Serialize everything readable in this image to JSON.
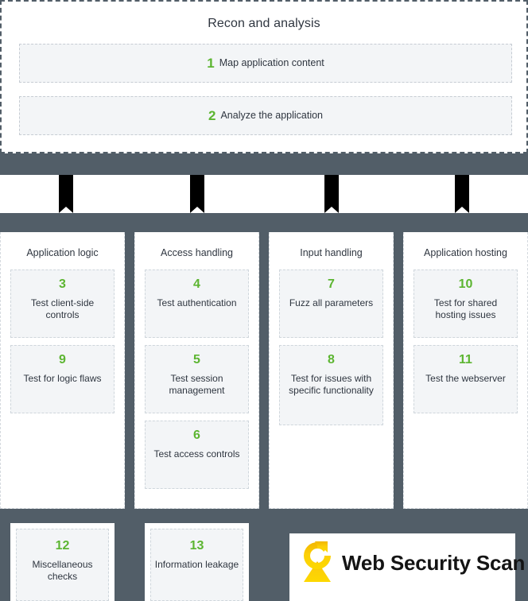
{
  "colors": {
    "dark_band": "#525e68",
    "accent_green": "#5cb531",
    "card_bg": "#f3f5f7",
    "text": "#2f3640",
    "logo_gold": "#f0b800",
    "logo_yellow": "#ffd400"
  },
  "recon": {
    "title": "Recon and analysis",
    "steps": [
      {
        "num": "1",
        "label": "Map application content"
      },
      {
        "num": "2",
        "label": "Analyze the application"
      }
    ]
  },
  "columns": [
    {
      "title": "Application logic",
      "cards": [
        {
          "num": "3",
          "text": "Test client-side controls"
        },
        {
          "num": "9",
          "text": "Test for logic flaws"
        }
      ]
    },
    {
      "title": "Access handling",
      "cards": [
        {
          "num": "4",
          "text": "Test authentication"
        },
        {
          "num": "5",
          "text": "Test session management"
        },
        {
          "num": "6",
          "text": "Test access controls"
        }
      ]
    },
    {
      "title": "Input handling",
      "cards": [
        {
          "num": "7",
          "text": "Fuzz all parameters"
        },
        {
          "num": "8",
          "text": "Test for issues with specific functionality"
        }
      ]
    },
    {
      "title": "Application hosting",
      "cards": [
        {
          "num": "10",
          "text": "Test for shared hosting issues"
        },
        {
          "num": "11",
          "text": "Test the webserver"
        }
      ]
    }
  ],
  "bottom_cards": [
    {
      "num": "12",
      "text": "Miscellaneous checks"
    },
    {
      "num": "13",
      "text": "Information leakage"
    }
  ],
  "logo": {
    "text": "Web Security Scan",
    "icon": "scan-circle-arrow-icon"
  }
}
